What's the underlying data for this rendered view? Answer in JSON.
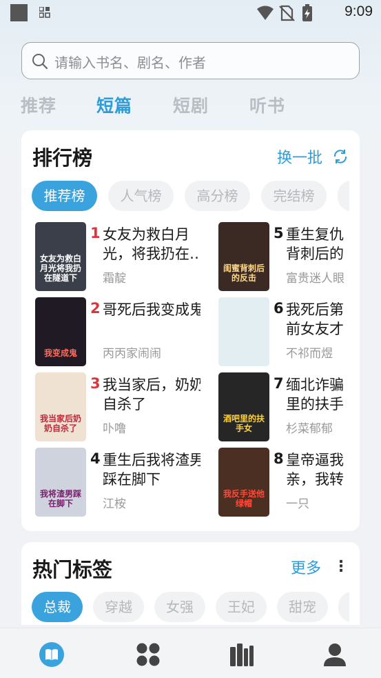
{
  "status_bar": {
    "time": "9:09"
  },
  "search": {
    "placeholder": "请输入书名、剧名、作者"
  },
  "tabs": [
    {
      "label": "推荐",
      "active": false
    },
    {
      "label": "短篇",
      "active": true
    },
    {
      "label": "短剧",
      "active": false
    },
    {
      "label": "听书",
      "active": false
    }
  ],
  "ranking": {
    "title": "排行榜",
    "refresh_label": "换一批",
    "pills": [
      {
        "label": "推荐榜",
        "active": true
      },
      {
        "label": "人气榜",
        "active": false
      },
      {
        "label": "高分榜",
        "active": false
      },
      {
        "label": "完结榜",
        "active": false
      }
    ],
    "books": [
      {
        "rank": "1",
        "title": "女友为救白月光，将我扔在…",
        "author": "霜靛",
        "cover_text": "女友为救白月光将我扔在隧道下",
        "cover_bg": "#3a3f4a",
        "cover_fg": "#ffffff",
        "rank_color": "#d9363e"
      },
      {
        "rank": "2",
        "title": "哥死后我变成鬼",
        "author": "丙丙家闹闹",
        "cover_text": "我变成鬼",
        "cover_bg": "#1f1a24",
        "cover_fg": "#ff6a5c",
        "rank_color": "#d9363e"
      },
      {
        "rank": "3",
        "title": "我当家后，奶奶自杀了",
        "author": "卟噜",
        "cover_text": "我当家后奶奶自杀了",
        "cover_bg": "#efe2d2",
        "cover_fg": "#c0283a",
        "rank_color": "#d9363e"
      },
      {
        "rank": "4",
        "title": "重生后我将渣男踩在脚下",
        "author": "江桉",
        "cover_text": "我将渣男踩在脚下",
        "cover_bg": "#cfd3dd",
        "cover_fg": "#7a1e6e",
        "rank_color": "#1a1a1a"
      },
      {
        "rank": "5",
        "title": "重生复仇背刺后的",
        "author": "富贵迷人眼",
        "cover_text": "闺蜜背刺后的反击",
        "cover_bg": "#3b2a24",
        "cover_fg": "#ffd98a",
        "rank_color": "#1a1a1a"
      },
      {
        "rank": "6",
        "title": "我死后第前女友才",
        "author": "不祁而煜",
        "cover_text": "",
        "cover_bg": "#e3eef2",
        "cover_fg": "#333333",
        "rank_color": "#1a1a1a"
      },
      {
        "rank": "7",
        "title": "缅北诈骗里的扶手",
        "author": "杉菜郁郁",
        "cover_text": "酒吧里的扶手女",
        "cover_bg": "#262626",
        "cover_fg": "#ffd23a",
        "rank_color": "#1a1a1a"
      },
      {
        "rank": "8",
        "title": "皇帝逼我亲，我转",
        "author": "一只",
        "cover_text": "我反手送他绿帽",
        "cover_bg": "#4a2f22",
        "cover_fg": "#ff4a3a",
        "rank_color": "#1a1a1a"
      }
    ]
  },
  "hot_tags": {
    "title": "热门标签",
    "more_label": "更多",
    "tags": [
      {
        "label": "总裁",
        "active": true
      },
      {
        "label": "穿越",
        "active": false
      },
      {
        "label": "女强",
        "active": false
      },
      {
        "label": "王妃",
        "active": false
      },
      {
        "label": "甜宠",
        "active": false
      }
    ]
  },
  "bottom_nav": [
    {
      "icon": "book-icon",
      "active": true
    },
    {
      "icon": "grid-icon",
      "active": false
    },
    {
      "icon": "bookshelf-icon",
      "active": false
    },
    {
      "icon": "profile-icon",
      "active": false
    }
  ],
  "colors": {
    "accent": "#2e9cd6",
    "rank_top": "#d9363e"
  }
}
